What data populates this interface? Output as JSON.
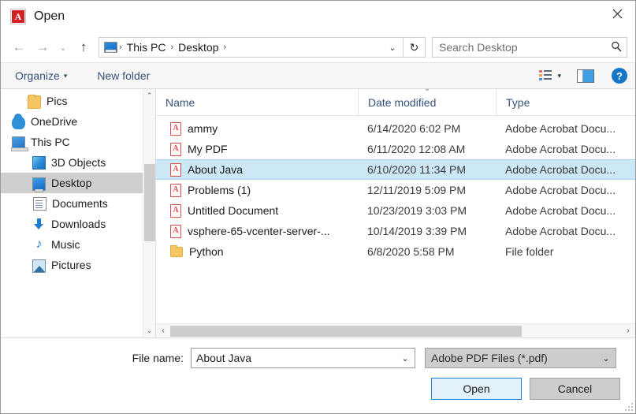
{
  "window": {
    "title": "Open",
    "app_icon": "adobe-acrobat-icon",
    "close_label": "✕"
  },
  "nav": {
    "back": "←",
    "forward": "→",
    "recent": "⌄",
    "up": "↑",
    "refresh": "↻",
    "breadcrumb_dropdown": "⌄",
    "crumbs": [
      {
        "label": "This PC"
      },
      {
        "label": "Desktop"
      }
    ],
    "separator": "›"
  },
  "search": {
    "placeholder": "Search Desktop",
    "value": "",
    "icon": "🔍"
  },
  "commandbar": {
    "organize_label": "Organize",
    "organize_caret": "▾",
    "new_folder_label": "New folder",
    "view_caret": "▾",
    "help_label": "?"
  },
  "sidebar": {
    "items": [
      {
        "label": "Pics",
        "icon": "folder-icon",
        "indent": 1,
        "selected": false
      },
      {
        "label": "OneDrive",
        "icon": "cloud-icon",
        "indent": 0,
        "selected": false
      },
      {
        "label": "This PC",
        "icon": "computer-icon",
        "indent": 0,
        "selected": false
      },
      {
        "label": "3D Objects",
        "icon": "cube-icon",
        "indent": 1,
        "selected": false
      },
      {
        "label": "Desktop",
        "icon": "desktop-icon",
        "indent": 1,
        "selected": true
      },
      {
        "label": "Documents",
        "icon": "document-icon",
        "indent": 1,
        "selected": false
      },
      {
        "label": "Downloads",
        "icon": "download-icon",
        "indent": 1,
        "selected": false
      },
      {
        "label": "Music",
        "icon": "music-icon",
        "indent": 1,
        "selected": false
      },
      {
        "label": "Pictures",
        "icon": "pictures-icon",
        "indent": 1,
        "selected": false
      }
    ],
    "scroll_up": "⌃",
    "scroll_down": "⌄"
  },
  "filelist": {
    "columns": [
      {
        "key": "name",
        "label": "Name",
        "sorted": false
      },
      {
        "key": "date",
        "label": "Date modified",
        "sorted": true,
        "sort_indicator": "⌄"
      },
      {
        "key": "type",
        "label": "Type",
        "sorted": false
      }
    ],
    "rows": [
      {
        "name": "ammy",
        "date": "6/14/2020 6:02 PM",
        "type": "Adobe Acrobat Docu...",
        "icon": "pdf-icon",
        "selected": false
      },
      {
        "name": "My PDF",
        "date": "6/11/2020 12:08 AM",
        "type": "Adobe Acrobat Docu...",
        "icon": "pdf-icon",
        "selected": false
      },
      {
        "name": "About Java",
        "date": "6/10/2020 11:34 PM",
        "type": "Adobe Acrobat Docu...",
        "icon": "pdf-icon",
        "selected": true
      },
      {
        "name": "Problems (1)",
        "date": "12/11/2019 5:09 PM",
        "type": "Adobe Acrobat Docu...",
        "icon": "pdf-icon",
        "selected": false
      },
      {
        "name": "Untitled Document",
        "date": "10/23/2019 3:03 PM",
        "type": "Adobe Acrobat Docu...",
        "icon": "pdf-icon",
        "selected": false
      },
      {
        "name": "vsphere-65-vcenter-server-...",
        "date": "10/14/2019 3:39 PM",
        "type": "Adobe Acrobat Docu...",
        "icon": "pdf-icon",
        "selected": false
      },
      {
        "name": "Python",
        "date": "6/8/2020 5:58 PM",
        "type": "File folder",
        "icon": "folder-icon",
        "selected": false
      }
    ],
    "hscroll_left": "‹",
    "hscroll_right": "›"
  },
  "footer": {
    "file_name_label": "File name:",
    "file_name_value": "About Java",
    "file_name_caret": "⌄",
    "file_type_value": "Adobe PDF Files (*.pdf)",
    "file_type_caret": "⌄",
    "open_label": "Open",
    "cancel_label": "Cancel"
  },
  "colors": {
    "selection_blue": "#cce8f7",
    "accent_blue": "#1883d7",
    "link_text": "#35527a",
    "sidebar_selected": "#cfcfcf",
    "acrobat_red": "#d32020"
  }
}
